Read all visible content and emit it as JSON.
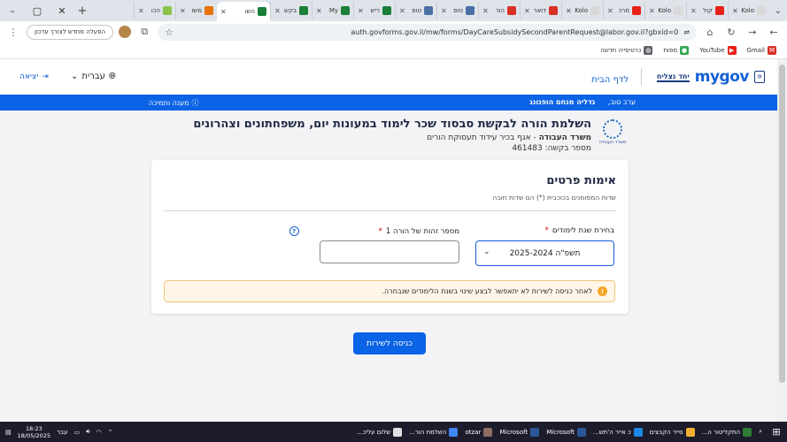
{
  "browser": {
    "tabs": [
      {
        "label": "Kolo",
        "color": "#d9d9d9"
      },
      {
        "label": "קול",
        "color": "#e62117"
      },
      {
        "label": "Kolo",
        "color": "#d9d9d9"
      },
      {
        "label": "מרכ",
        "color": "#e62117"
      },
      {
        "label": "Kolo",
        "color": "#d9d9d9"
      },
      {
        "label": "דואר",
        "color": "#d93025"
      },
      {
        "label": "הור",
        "color": "#d93025"
      },
      {
        "label": "טופ",
        "color": "#4a6fa5"
      },
      {
        "label": "טופ",
        "color": "#4a6fa5"
      },
      {
        "label": "ריש",
        "color": "#1a7f37"
      },
      {
        "label": "My",
        "color": "#1a7f37"
      },
      {
        "label": "בקש",
        "color": "#1a7f37"
      },
      {
        "label": "השו",
        "color": "#1a7f37",
        "active": true
      },
      {
        "label": "משו",
        "color": "#e8710a"
      },
      {
        "label": "הכו",
        "color": "#8bc34a"
      }
    ],
    "url": "auth.govforms.gov.il/mw/forms/DayCareSubsidySecondParentRequest@labor.gov.il?gbxid=0",
    "relaunch_label": "הפעלה מחדש לצורך עדכון",
    "bookmarks": [
      "Gmail",
      "YouTube",
      "מפות",
      "כרטיסייה חדשה"
    ]
  },
  "site": {
    "logo_text": "mygov",
    "logo_tagline": "יחד נצליח",
    "home_link": "לדף הבית",
    "language": "עברית",
    "logout": "יציאה",
    "greeting": "ערב טוב,",
    "user_name": "גדליה מנחם הופנונג",
    "help_link": "מענה ותמיכה"
  },
  "service": {
    "title": "השלמת הורה לבקשת סבסוד שכר לימוד במעונות יום, משפחתונים וצהרונים",
    "ministry": "משרד העבודה",
    "department": " - אגף בכיר עידוד תעסוקת הורים",
    "request_label": "מספר בקשה:",
    "request_number": "461483",
    "ministry_logo_label": "משרד העבודה"
  },
  "form": {
    "title": "אימות פרטים",
    "required_note": "שדות המסומנים בכוכבית (*) הם שדות חובה",
    "year_label": "בחירת שנת לימודים",
    "year_value": "תשפ\"ה 2025-2024",
    "id_label": "מספר זהות של הורה 1",
    "warning": "לאחר כניסה לשירות לא יתאפשר לבצע שינוי בשנת הלימודים שנבחרה.",
    "enter_button": "כניסה לשירות"
  },
  "taskbar": {
    "items": [
      {
        "label": "התקליטור ה...",
        "color": "#2e7d32"
      },
      {
        "label": "סייר הקבצים",
        "color": "#f2b134"
      },
      {
        "label": "כ אייר ה'תש...",
        "color": "#1e88e5"
      },
      {
        "label": "Microsoft",
        "color": "#2b579a"
      },
      {
        "label": "Microsoft",
        "color": "#2b579a"
      },
      {
        "label": "otzar",
        "color": "#8d6e63"
      },
      {
        "label": "השלמת הור...",
        "color": "#4285f4"
      },
      {
        "label": "שלום עליכ...",
        "color": "#e0e0e0"
      }
    ],
    "lang": "עבר",
    "time": "18:23",
    "date": "18/05/2025"
  }
}
